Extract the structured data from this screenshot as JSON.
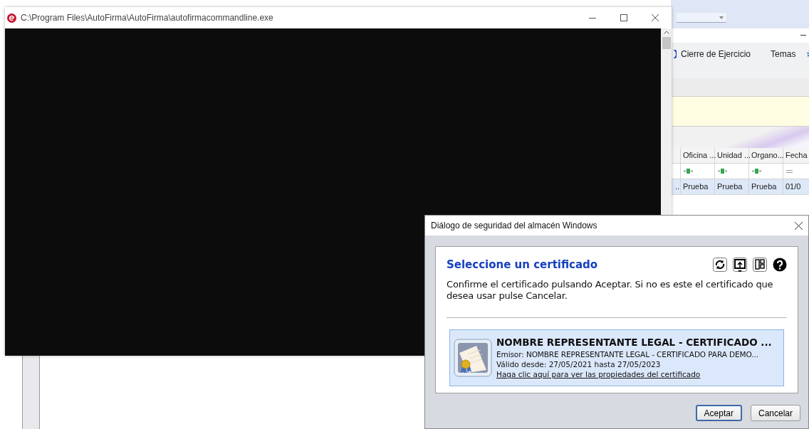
{
  "background_app": {
    "menu": [
      "Cierre de Ejercicio",
      "Temas"
    ],
    "table": {
      "columns": [
        "",
        "Oficina ...",
        "Unidad ...",
        "Organo...",
        "Fecha"
      ],
      "filters": [
        {
          "kind": "none"
        },
        {
          "kind": "text"
        },
        {
          "kind": "text"
        },
        {
          "kind": "text"
        },
        {
          "kind": "date"
        }
      ],
      "rows": [
        {
          "cells": [
            "..",
            "Prueba",
            "Prueba",
            "Prueba",
            "01/0"
          ],
          "selected": true
        }
      ]
    }
  },
  "console_window": {
    "title": "C:\\Program Files\\AutoFirma\\AutoFirma\\autofirmacommandline.exe"
  },
  "dialog": {
    "title": "Diálogo de seguridad del almacén Windows",
    "heading": "Seleccione un certificado",
    "message": "Confirme el certificado pulsando Aceptar. Si no es este el certificado que desea usar pulse Cancelar.",
    "certificates": [
      {
        "name": "NOMBRE REPRESENTANTE LEGAL - CERTIFICADO ...",
        "issuer": "Emisor: NOMBRE REPRESENTANTE LEGAL - CERTIFICADO PARA DEMO...",
        "validity": "Válido desde: 27/05/2021 hasta 27/05/2023",
        "link": "Haga clic aquí para ver las propiedades del certificado",
        "selected": true
      }
    ],
    "buttons": [
      {
        "label": "Aceptar",
        "default": true
      },
      {
        "label": "Cancelar",
        "default": false
      }
    ]
  }
}
